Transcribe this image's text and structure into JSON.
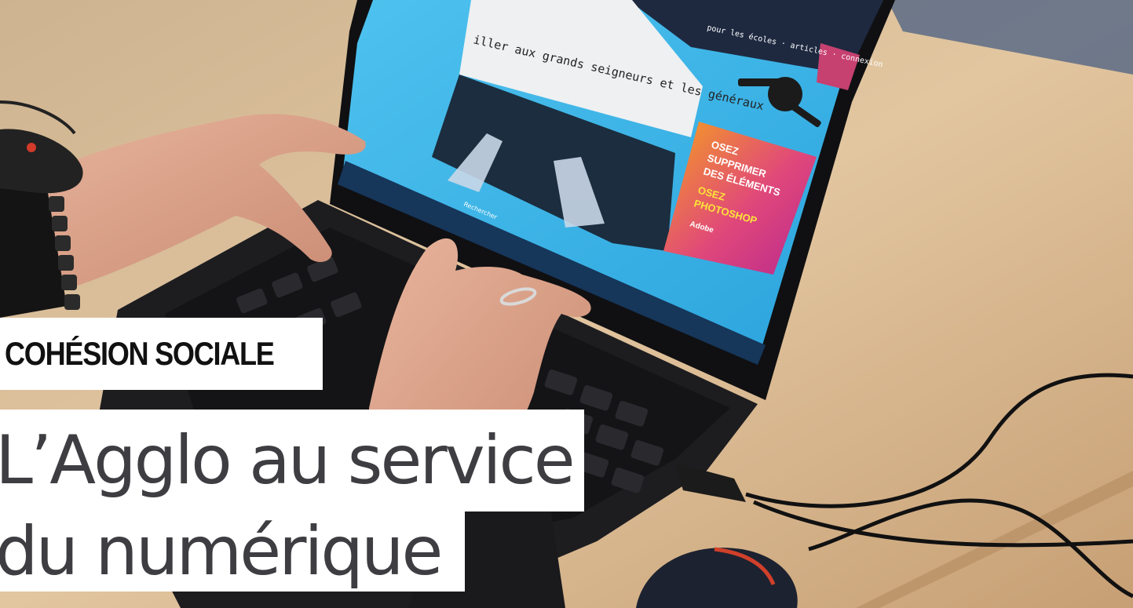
{
  "category_label": "COHÉSION SOCIALE",
  "headline": {
    "line1": "L’Agglo au service",
    "line2": "du numérique"
  },
  "screen_text": {
    "nav_links": "pour les écoles · articles · connexion",
    "typing_line": "iller aux grands seigneurs et les généraux",
    "ad_line1": "OSEZ",
    "ad_line2": "SUPPRIMER",
    "ad_line3": "DES ÉLÉMENTS",
    "ad_line4": "OSEZ",
    "ad_line5": "PHOTOSHOP",
    "ad_brand": "Adobe",
    "taskbar_search": "Rechercher"
  },
  "colors": {
    "label_bg": "#ffffff",
    "label_text": "#111111",
    "headline_text": "#3e3e42",
    "desk": "#d9b98f",
    "screen": "#3cb4e6",
    "ad_gradient_start": "#f5a020",
    "ad_gradient_end": "#c0288a"
  }
}
